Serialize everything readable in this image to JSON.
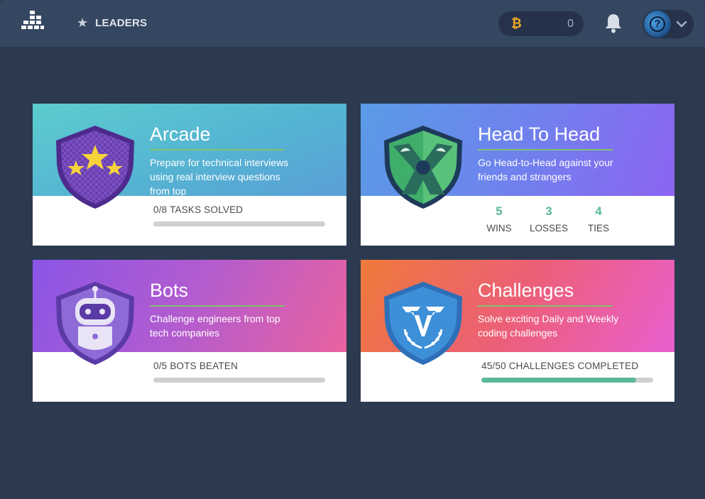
{
  "header": {
    "leaders_label": "LEADERS",
    "coins_count": "0"
  },
  "cards": {
    "arcade": {
      "title": "Arcade",
      "description": "Prepare for technical interviews using real interview questions from top",
      "progress_label": "0/8 TASKS SOLVED",
      "progress_fraction": 0
    },
    "h2h": {
      "title": "Head To Head",
      "description": "Go Head-to-Head against your friends and strangers",
      "stats": [
        {
          "value": "5",
          "label": "WINS"
        },
        {
          "value": "3",
          "label": "LOSSES"
        },
        {
          "value": "4",
          "label": "TIES"
        }
      ]
    },
    "bots": {
      "title": "Bots",
      "description": "Challenge engineers from top tech companies",
      "progress_label": "0/5 BOTS BEATEN",
      "progress_fraction": 0
    },
    "challenges": {
      "title": "Challenges",
      "description": "Solve exciting Daily and Weekly coding challenges",
      "progress_label": "45/50 CHALLENGES COMPLETED",
      "progress_fraction": 0.9
    }
  },
  "colors": {
    "progress_fill": "#5cb79b",
    "title_rule": "#7ec36a",
    "bitcoin": "#f0a92a"
  },
  "icons": {
    "logo": "bar-logo-icon",
    "leaders": "star-icon",
    "coins": "bitcoin-icon",
    "notifications": "bell-icon",
    "profile_menu": "chevron-down-icon"
  }
}
